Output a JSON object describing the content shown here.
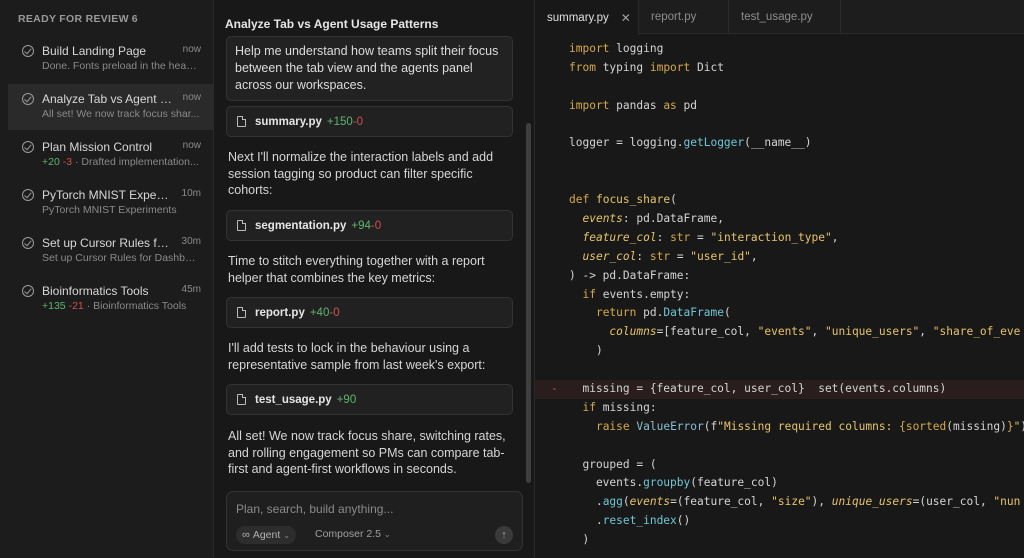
{
  "sidebar": {
    "header": "READY FOR REVIEW",
    "count": "6",
    "items": [
      {
        "title": "Build Landing Page",
        "time": "now",
        "sub": "Done. Fonts preload in the head, ...",
        "add": "",
        "del": "",
        "active": false
      },
      {
        "title": "Analyze Tab vs Agent Us...",
        "time": "now",
        "sub": "All set! We now track focus shar...",
        "add": "",
        "del": "",
        "active": true
      },
      {
        "title": "Plan Mission Control",
        "time": "now",
        "sub": "· Drafted implementation...",
        "add": "+20",
        "del": "-3",
        "active": false
      },
      {
        "title": "PyTorch MNIST Experim...",
        "time": "10m",
        "sub": "PyTorch MNIST Experiments",
        "add": "",
        "del": "",
        "active": false
      },
      {
        "title": "Set up Cursor Rules for ...",
        "time": "30m",
        "sub": "Set up Cursor Rules for Dashboa...",
        "add": "",
        "del": "",
        "active": false
      },
      {
        "title": "Bioinformatics Tools",
        "time": "45m",
        "sub": "· Bioinformatics Tools",
        "add": "+135",
        "del": "-21",
        "active": false
      }
    ]
  },
  "chat": {
    "title": "Analyze Tab vs Agent Usage Patterns",
    "user_message": "Help me understand how teams split their focus between the tab view and the agents panel across our workspaces.",
    "file1": {
      "name": "summary.py",
      "add": "+150",
      "del": "-0"
    },
    "msg1": "Next I'll normalize the interaction labels and add session tagging so product can filter specific cohorts:",
    "file2": {
      "name": "segmentation.py",
      "add": "+94",
      "del": "-0"
    },
    "msg2": "Time to stitch everything together with a report helper that combines the key metrics:",
    "file3": {
      "name": "report.py",
      "add": "+40",
      "del": "-0"
    },
    "msg3": "I'll add tests to lock in the behaviour using a representative sample from last week's export:",
    "file4": {
      "name": "test_usage.py",
      "add": "+90",
      "del": ""
    },
    "msg4": "All set! We now track focus share, switching rates, and rolling engagement so PMs can compare tab-first and agent-first workflows in seconds.",
    "composer": {
      "placeholder": "Plan, search, build anything...",
      "agent_label": "Agent",
      "agent_icon": "infinity-icon",
      "model_label": "Composer 2.5",
      "send_icon": "arrow-up-icon"
    }
  },
  "editor": {
    "tabs": [
      {
        "label": "summary.py",
        "active": true
      },
      {
        "label": "report.py",
        "active": false
      },
      {
        "label": "test_usage.py",
        "active": false
      }
    ],
    "deleted_marker": "-"
  }
}
